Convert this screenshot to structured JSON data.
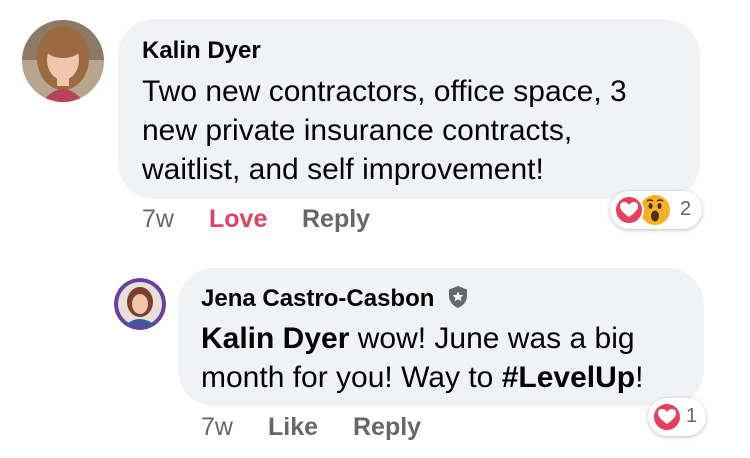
{
  "comments": [
    {
      "author": "Kalin Dyer",
      "text": "Two new contractors, office space, 3 new private insurance contracts, waitlist, and self improvement!",
      "text_lines": [
        "Two new contractors, office space, 3",
        "new private insurance contracts,",
        "waitlist, and self improvement!"
      ],
      "timestamp": "7w",
      "like_label": "Love",
      "reply_label": "Reply",
      "reactions": [
        "love-icon",
        "wow-icon"
      ],
      "reaction_count": "2"
    },
    {
      "author": "Jena Castro-Casbon",
      "author_badge": "shield-badge-icon",
      "mention": "Kalin Dyer",
      "text_line1_rest": " wow! June was a big",
      "text_line2_before": "month for you! Way to ",
      "hashtag": "#LevelUp",
      "text_line2_after": "!",
      "timestamp": "7w",
      "like_label": "Like",
      "reply_label": "Reply",
      "reactions": [
        "love-icon"
      ],
      "reaction_count": "1"
    }
  ],
  "colors": {
    "bubble": "#f0f2f5",
    "secondary_text": "#65676b",
    "love": "#e4405f",
    "wow": "#f7b125"
  }
}
